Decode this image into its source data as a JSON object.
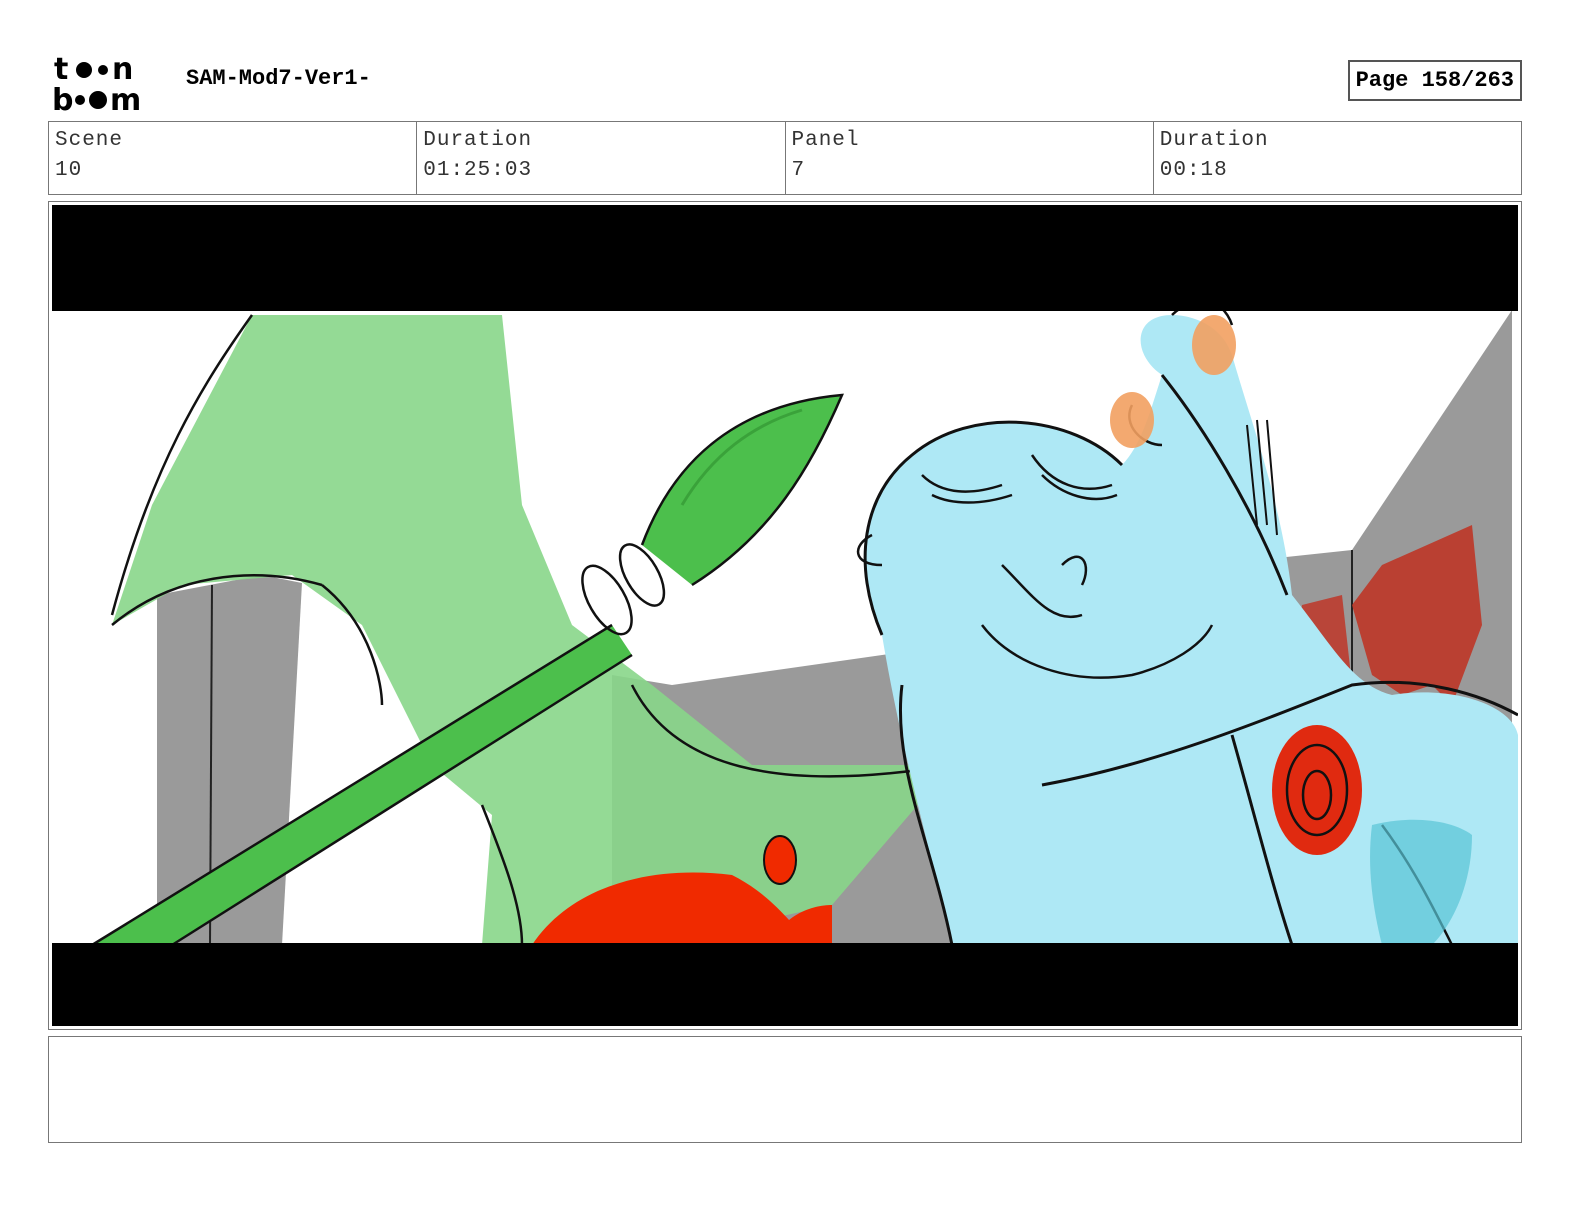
{
  "header": {
    "logo_top": "t●●n",
    "logo_bottom": "b●●m",
    "project_title": "SAM-Mod7-Ver1-",
    "page_label": "Page 158/263"
  },
  "info": {
    "scene_label": "Scene",
    "scene_value": "10",
    "scene_duration_label": "Duration",
    "scene_duration_value": "01:25:03",
    "panel_label": "Panel",
    "panel_value": "7",
    "panel_duration_label": "Duration",
    "panel_duration_value": "00:18"
  },
  "colors": {
    "letterbox": "#000000",
    "wall_gray": "#9a9a9a",
    "axe_green": "#88d68a",
    "handle_green": "#4cbf4c",
    "character_blue": "#aee8f5",
    "accent_red": "#f02a00",
    "blood_red": "#c03020",
    "orange": "#f2a060"
  },
  "notes": {
    "text": ""
  }
}
